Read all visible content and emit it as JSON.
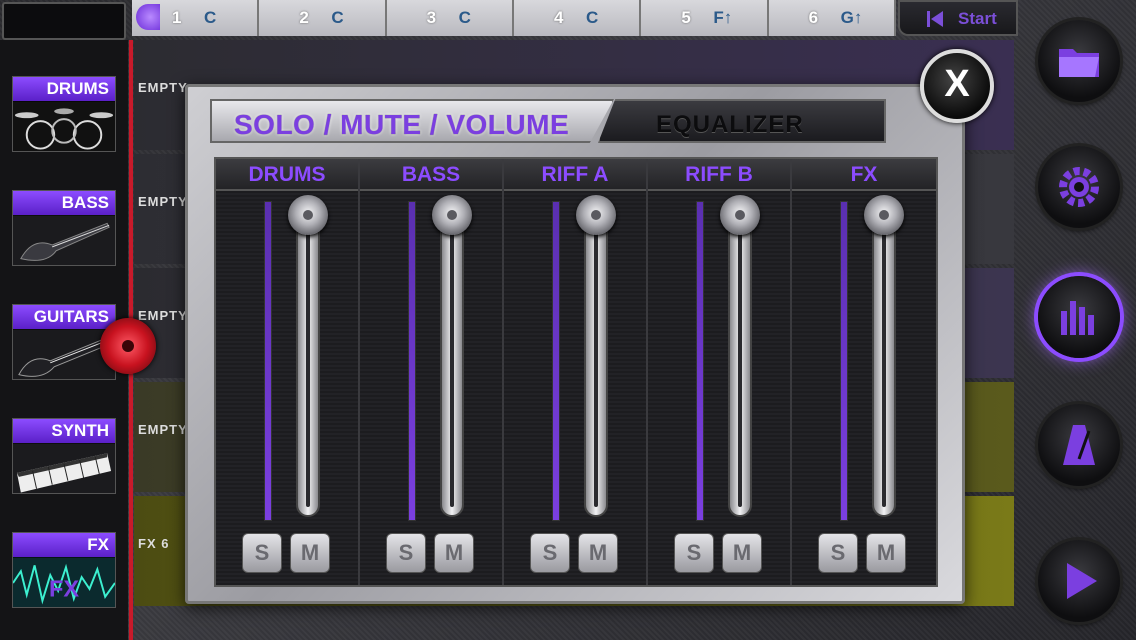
{
  "topbar": {
    "bars": [
      {
        "num": "1",
        "chord": "C"
      },
      {
        "num": "2",
        "chord": "C"
      },
      {
        "num": "3",
        "chord": "C"
      },
      {
        "num": "4",
        "chord": "C"
      },
      {
        "num": "5",
        "chord": "F↑"
      },
      {
        "num": "6",
        "chord": "G↑"
      }
    ],
    "start_label": "Start"
  },
  "instruments": [
    {
      "label": "DRUMS"
    },
    {
      "label": "BASS"
    },
    {
      "label": "GUITARS"
    },
    {
      "label": "SYNTH"
    },
    {
      "label": "FX"
    }
  ],
  "tracks": [
    {
      "label": "EMPTY",
      "color": "#2c2c31"
    },
    {
      "label": "EMPTY",
      "color": "#2d2d33"
    },
    {
      "label": "EMPTY",
      "color": "#2b2b30"
    },
    {
      "label": "EMPTY",
      "color": "#55551e"
    },
    {
      "label": "FX 6",
      "color": "#6a6a12"
    }
  ],
  "mixer": {
    "tab_active": "SOLO / MUTE / VOLUME",
    "tab_inactive": "EQUALIZER",
    "close_label": "X",
    "channels": [
      {
        "name": "DRUMS",
        "solo": "S",
        "mute": "M",
        "level": 1.0,
        "volume": 1.0
      },
      {
        "name": "BASS",
        "solo": "S",
        "mute": "M",
        "level": 1.0,
        "volume": 1.0
      },
      {
        "name": "RIFF A",
        "solo": "S",
        "mute": "M",
        "level": 1.0,
        "volume": 1.0
      },
      {
        "name": "RIFF B",
        "solo": "S",
        "mute": "M",
        "level": 1.0,
        "volume": 1.0
      },
      {
        "name": "FX",
        "solo": "S",
        "mute": "M",
        "level": 1.0,
        "volume": 1.0
      }
    ]
  },
  "right_controls": [
    {
      "icon": "folder-icon",
      "active": false
    },
    {
      "icon": "gear-icon",
      "active": false
    },
    {
      "icon": "mixer-icon",
      "active": true
    },
    {
      "icon": "metronome-icon",
      "active": false
    },
    {
      "icon": "play-icon",
      "active": false
    }
  ],
  "colors": {
    "accent": "#8c4cff",
    "playhead": "#c81a2a"
  }
}
